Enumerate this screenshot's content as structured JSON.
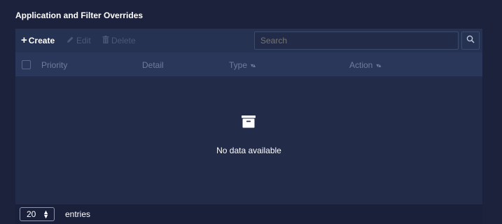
{
  "panel": {
    "title": "Application and Filter Overrides"
  },
  "toolbar": {
    "create_label": "Create",
    "edit_label": "Edit",
    "delete_label": "Delete",
    "search_placeholder": "Search"
  },
  "table": {
    "columns": [
      {
        "label": "Priority",
        "sortable": false
      },
      {
        "label": "Detail",
        "sortable": false
      },
      {
        "label": "Type",
        "sortable": true
      },
      {
        "label": "Action",
        "sortable": true
      }
    ],
    "empty_message": "No data available"
  },
  "footer": {
    "page_size": "20",
    "entries_label": "entries"
  },
  "icons": {
    "create": "plus-icon",
    "edit": "pencil-icon",
    "delete": "trash-icon",
    "search": "search-icon",
    "empty": "archive-box-icon",
    "sort": "sort-arrows-icon",
    "stepper": "up-down-chevron-icon"
  },
  "colors": {
    "background": "#1c223b",
    "toolbar": "#263252",
    "header": "#2b375a",
    "body": "#222b48",
    "disabled": "#4c5875"
  }
}
